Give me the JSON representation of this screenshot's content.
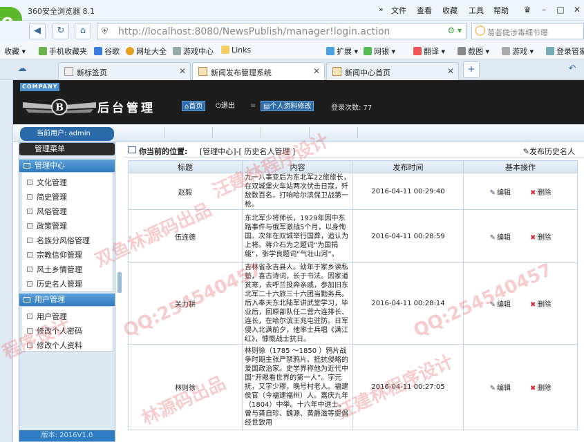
{
  "browser": {
    "title": "360安全浏览器 8.1",
    "menu": [
      "文件",
      "查看",
      "收藏",
      "工具",
      "帮助"
    ],
    "url": "http://localhost:8080/NewsPublish/manager!login.action",
    "search_text": "葛荟婕涉毒细节曝",
    "bookmarks": [
      "收藏",
      "手机收藏夹",
      "谷歌",
      "网址大全",
      "游戏中心",
      "Links",
      "扩展",
      "网银",
      "翻译",
      "截图",
      "游戏",
      "登录管家"
    ],
    "tabs": [
      "新标签页",
      "新闻发布管理系统",
      "新闻中心首页"
    ],
    "colors": {
      "accent": "#2f7bc1",
      "header": "#1d1d1d"
    }
  },
  "header": {
    "company": "COMPANY",
    "title": "后台管理",
    "home_label": "首页",
    "logout_label": "退出",
    "profile_label": "个人资料修改",
    "login_count": "登录次数: 77"
  },
  "user_bar": "当前用户: admin",
  "sidebar": {
    "menu_title": "管理菜单",
    "groups": [
      {
        "title": "管理中心",
        "items": [
          "文化管理",
          "简史管理",
          "风俗管理",
          "政策管理",
          "名族分风俗管理",
          "宗教信仰管理",
          "风土乡情管理",
          "历史名人管理"
        ]
      },
      {
        "title": "用户管理",
        "items": [
          "用户管理",
          "修改个人密码",
          "修改个人资料"
        ]
      }
    ],
    "version": "版本: 2016V1.0"
  },
  "main": {
    "pos_label": "你当前的位置:",
    "path": "[管理中心]-[ 历史名人管理 ]",
    "add_label": "发布历史名人",
    "columns": [
      "标题",
      "内容",
      "发布时间",
      "基本操作"
    ],
    "edit_label": "编辑",
    "delete_label": "删除",
    "rows": [
      {
        "title": "赵毅",
        "content": "九一八事变后为东北军22旅旅长，在双城堡火车站两次伏击日寇，歼敌数百名，打响哈尔滨保卫战第一枪。",
        "time": "2016-04-11 00:29:40"
      },
      {
        "title": "伍连德",
        "content": "东北军少将师长，1929年因中东路事件与俄军激战5个月，以身殉国。次年在双城举行国葬，追认为上将。蒋介石为之题词“为国捐躯”，张学良题词“气壮山河”。",
        "time": "2016-04-11 00:28:59"
      },
      {
        "title": "关力耕",
        "content": "吉林省永吉县人。幼年于家乡读私塾，喜古诗词，长于书法。因家道贫寒，去呼兰投奔亲戚，参加旧东北军二十六旅三十六团当勤务兵。后入奉天东北陆军讲武堂学习，毕业后，回原部队任二营六连排长、连长，在哈尔滨王兆屯驻防。日军侵入北满前夕，他率士兵唱《满江红》，慷慨战士抗日。",
        "time": "2016-04-11 00:28:14"
      },
      {
        "title": "林则徐",
        "content": "林则徐（1785 ～1850 ）鸦片战争时期主张严禁鸦片、抵抗侵略的爱国政治家。史学界称他为近代中国“开眼看世界的第一人”。字元抚，又字少穆，晚号村老人。福建侯官（今福建福州）人。嘉庆九年（1804）中举。十六年中进士。曾与龚自珍、魏源、黄爵滋等提倡经世致用",
        "time": "2016-04-11 00:27:05"
      }
    ]
  },
  "watermarks": [
    "汪建林程序设计",
    "QQ:254540457",
    "双鱼林源码出品",
    "林源码出品",
    "程序设计"
  ]
}
